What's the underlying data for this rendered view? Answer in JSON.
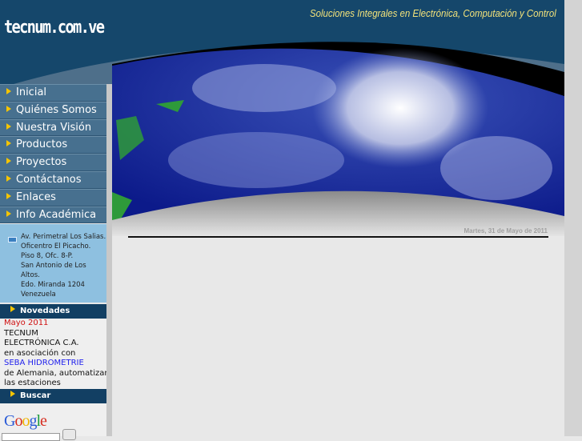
{
  "header": {
    "logo": "tecnum.com.ve",
    "tagline": "Soluciones  Integrales en Electrónica, Computación y Control"
  },
  "menu": [
    {
      "label": "Inicial"
    },
    {
      "label": "Quiénes Somos"
    },
    {
      "label": "Nuestra Visión"
    },
    {
      "label": "Productos"
    },
    {
      "label": "Proyectos"
    },
    {
      "label": "Contáctanos"
    },
    {
      "label": "Enlaces"
    },
    {
      "label": "Info Académica"
    }
  ],
  "address": [
    "Av. Perimetral Los Salias.",
    "Oficentro El Picacho.",
    "Piso 8, Ofc. 8-P.",
    "San Antonio de Los Altos.",
    "Edo. Miranda 1204",
    "Venezuela"
  ],
  "novedades": {
    "title": "Novedades",
    "date": "Mayo 2011",
    "lines": [
      "TECNUM",
      "ELECTRÓNICA C.A.",
      "en asociación con"
    ],
    "link": "SEBA HIDROMETRIE",
    "after": [
      "de Alemania, automatizan",
      "las estaciones"
    ]
  },
  "search": {
    "title": "Buscar",
    "logo": "Google"
  },
  "main": {
    "date": "Martes, 31 de Mayo de 2011"
  }
}
